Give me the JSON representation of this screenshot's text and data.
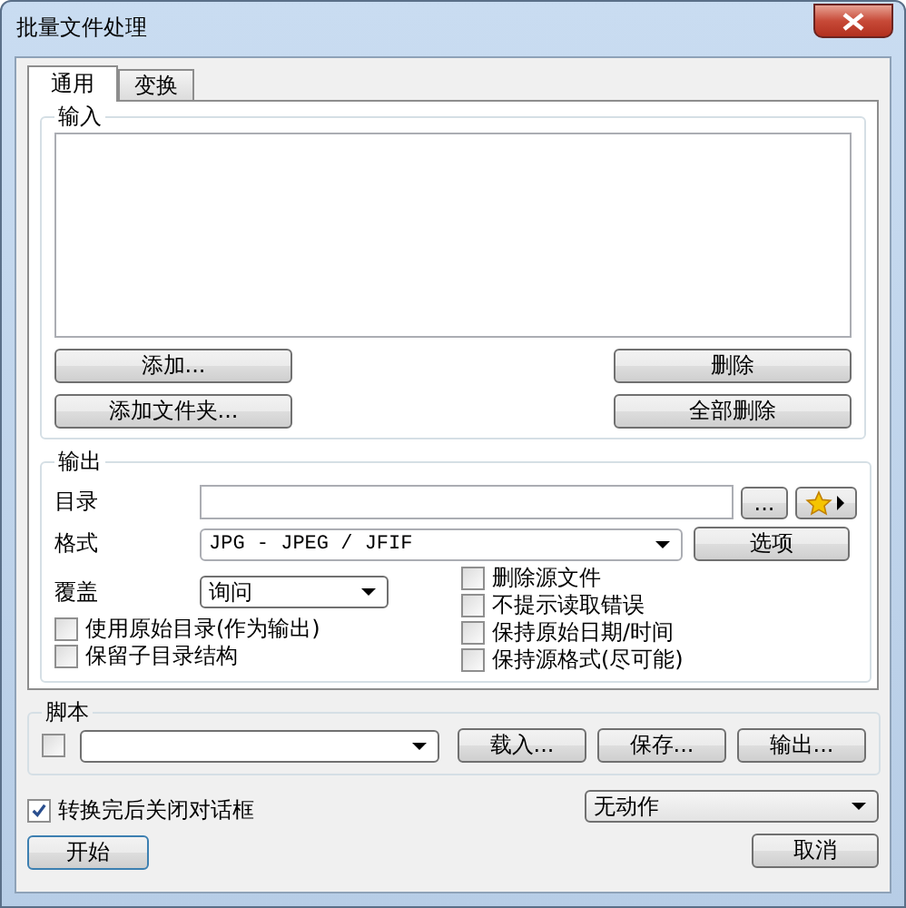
{
  "window": {
    "title": "批量文件处理"
  },
  "tabs": [
    {
      "label": "通用",
      "selected": true
    },
    {
      "label": "变换",
      "selected": false
    }
  ],
  "input_group": {
    "label": "输入",
    "buttons_left": [
      "添加...",
      "添加文件夹..."
    ],
    "buttons_right": [
      "删除",
      "全部删除"
    ]
  },
  "output_group": {
    "label": "输出",
    "directory": {
      "label": "目录",
      "browse": "..."
    },
    "format": {
      "label": "格式",
      "value": "JPG - JPEG / JFIF",
      "options_button": "选项"
    },
    "overwrite": {
      "label": "覆盖",
      "value": "询问"
    },
    "checkboxes_left": [
      {
        "label": "使用原始目录(作为输出)",
        "checked": false
      },
      {
        "label": "保留子目录结构",
        "checked": false
      }
    ],
    "checkboxes_right": [
      {
        "label": "删除源文件",
        "checked": false
      },
      {
        "label": "不提示读取错误",
        "checked": false
      },
      {
        "label": "保持原始日期/时间",
        "checked": false
      },
      {
        "label": "保持源格式(尽可能)",
        "checked": false
      }
    ]
  },
  "script_group": {
    "label": "脚本",
    "enabled": false,
    "buttons": [
      "载入...",
      "保存...",
      "输出..."
    ]
  },
  "close_after": {
    "label": "转换完后关闭对话框",
    "checked": true
  },
  "action_select": {
    "value": "无动作"
  },
  "buttons": [
    "开始",
    "取消"
  ]
}
